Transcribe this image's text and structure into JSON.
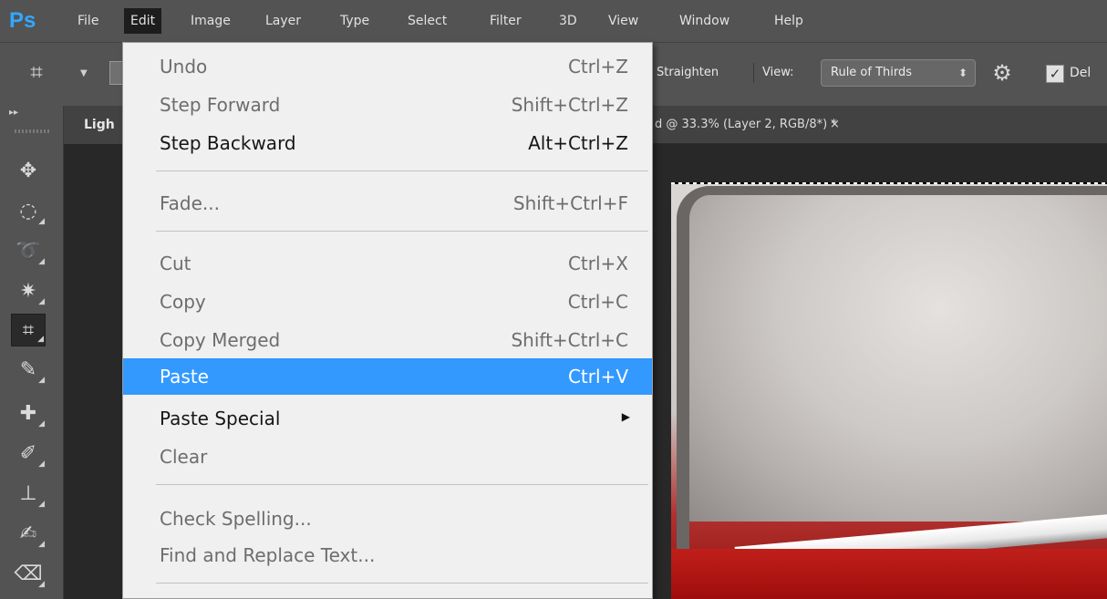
{
  "app": {
    "logo": "Ps",
    "menubar": [
      "File",
      "Edit",
      "Image",
      "Layer",
      "Type",
      "Select",
      "Filter",
      "3D",
      "View",
      "Window",
      "Help"
    ],
    "open_menu": "Edit"
  },
  "options_bar": {
    "tool_icon": "crop-icon",
    "straighten_label": "Straighten",
    "view_label": "View:",
    "view_value": "Rule of Thirds",
    "delete_label": "Del",
    "delete_checked": true
  },
  "document_tabs": {
    "left_tab": "Ligh",
    "right_tab": "d @ 33.3% (Layer 2, RGB/8*) *",
    "close_glyph": "×"
  },
  "tools": [
    "move-tool",
    "marquee-tool",
    "lasso-tool",
    "magic-wand-tool",
    "crop-tool",
    "eyedropper-tool",
    "spot-healing-tool",
    "brush-tool",
    "clone-stamp-tool",
    "history-brush-tool",
    "eraser-tool"
  ],
  "active_tool": "crop-tool",
  "edit_menu": [
    {
      "label": "Undo",
      "shortcut": "Ctrl+Z",
      "enabled": false
    },
    {
      "label": "Step Forward",
      "shortcut": "Shift+Ctrl+Z",
      "enabled": false
    },
    {
      "label": "Step Backward",
      "shortcut": "Alt+Ctrl+Z",
      "enabled": true
    },
    {
      "label": "Fade...",
      "shortcut": "Shift+Ctrl+F",
      "enabled": false
    },
    {
      "label": "Cut",
      "shortcut": "Ctrl+X",
      "enabled": false
    },
    {
      "label": "Copy",
      "shortcut": "Ctrl+C",
      "enabled": false
    },
    {
      "label": "Copy Merged",
      "shortcut": "Shift+Ctrl+C",
      "enabled": false
    },
    {
      "label": "Paste",
      "shortcut": "Ctrl+V",
      "enabled": true,
      "highlighted": true
    },
    {
      "label": "Paste Special",
      "shortcut": "",
      "enabled": true,
      "submenu": true
    },
    {
      "label": "Clear",
      "shortcut": "",
      "enabled": false
    },
    {
      "label": "Check Spelling...",
      "shortcut": "",
      "enabled": false
    },
    {
      "label": "Find and Replace Text...",
      "shortcut": "",
      "enabled": false
    }
  ],
  "colors": {
    "menubar": "#535353",
    "menu_bg": "#f0f0f0",
    "highlight": "#3399ff",
    "ps_logo": "#31a8ff"
  }
}
